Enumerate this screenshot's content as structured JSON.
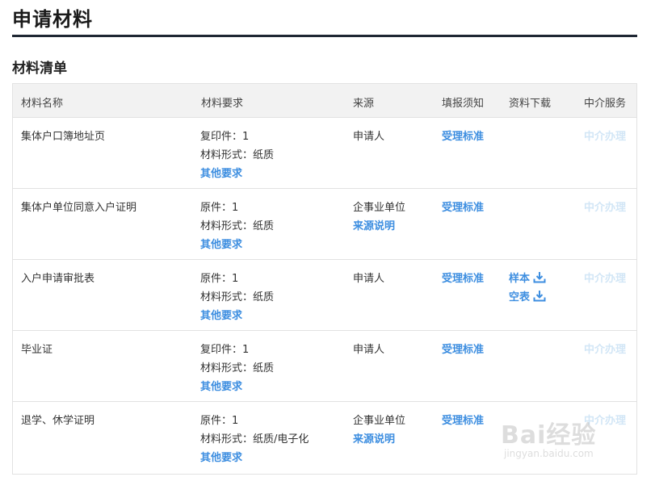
{
  "page": {
    "title": "申请材料",
    "section_title": "材料清单"
  },
  "table": {
    "headers": [
      "材料名称",
      "材料要求",
      "来源",
      "填报须知",
      "资料下载",
      "中介服务"
    ],
    "rows": [
      {
        "name": "集体户口簿地址页",
        "req_line1": "复印件：1",
        "req_line2": "材料形式：纸质",
        "req_link": "其他要求",
        "source": "申请人",
        "source_link": "",
        "notice": "受理标准",
        "dl1": "",
        "dl2": "",
        "agent": "中介办理"
      },
      {
        "name": "集体户单位同意入户证明",
        "req_line1": "原件：1",
        "req_line2": "材料形式：纸质",
        "req_link": "其他要求",
        "source": "企事业单位",
        "source_link": "来源说明",
        "notice": "受理标准",
        "dl1": "",
        "dl2": "",
        "agent": "中介办理"
      },
      {
        "name": "入户申请审批表",
        "req_line1": "原件：1",
        "req_line2": "材料形式：纸质",
        "req_link": "其他要求",
        "source": "申请人",
        "source_link": "",
        "notice": "受理标准",
        "dl1": "样本",
        "dl2": "空表",
        "agent": "中介办理"
      },
      {
        "name": "毕业证",
        "req_line1": "复印件：1",
        "req_line2": "材料形式：纸质",
        "req_link": "其他要求",
        "source": "申请人",
        "source_link": "",
        "notice": "受理标准",
        "dl1": "",
        "dl2": "",
        "agent": "中介办理"
      },
      {
        "name": "退学、休学证明",
        "req_line1": "原件：1",
        "req_line2": "材料形式：纸质/电子化",
        "req_link": "其他要求",
        "source": "企事业单位",
        "source_link": "来源说明",
        "notice": "受理标准",
        "dl1": "",
        "dl2": "",
        "agent": "中介办理"
      }
    ]
  },
  "watermark": {
    "brand": "Bai经验",
    "url": "jingyan.baidu.com"
  },
  "colors": {
    "link": "#3d8ee0",
    "disabled_link": "#d2e6f6",
    "rule": "#1f2733",
    "header_bg": "#f2f2f2"
  },
  "icons": {
    "download": "download-icon"
  }
}
